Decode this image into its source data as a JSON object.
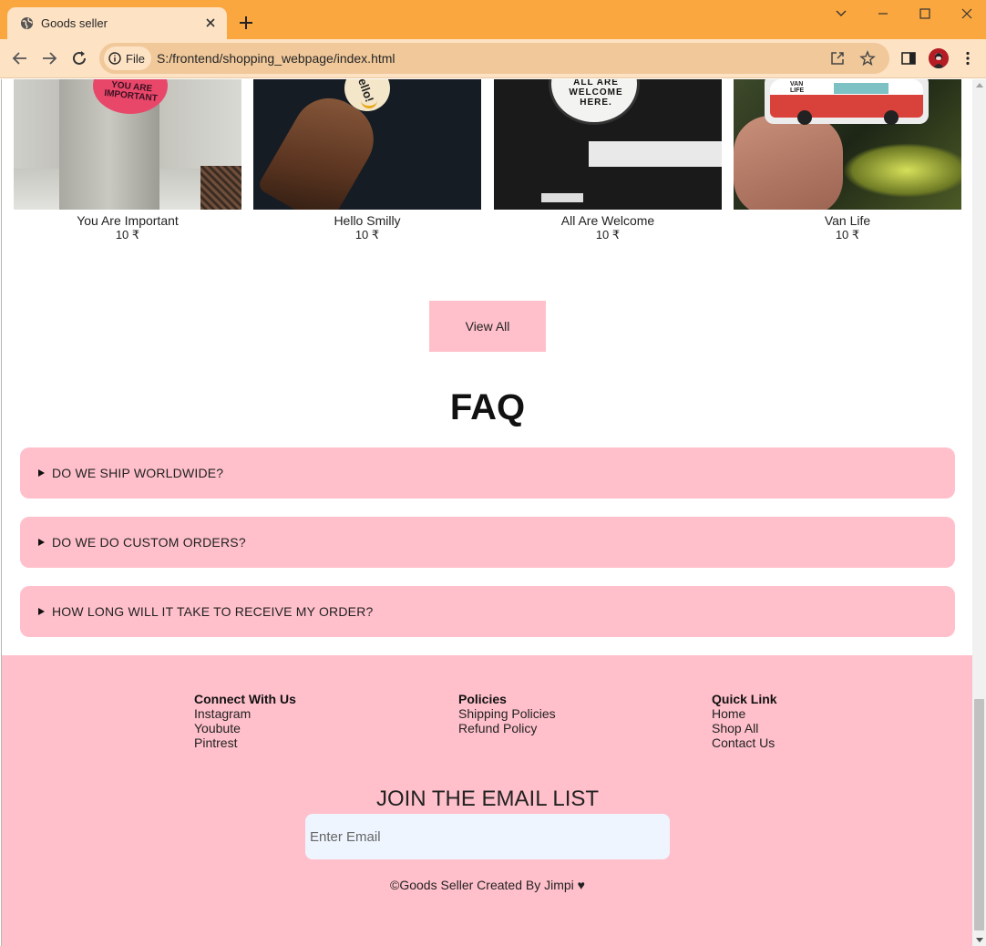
{
  "browser": {
    "tab_title": "Goods seller",
    "chip_label": "File",
    "url": "S:/frontend/shopping_webpage/index.html"
  },
  "products": [
    {
      "name": "You Are Important",
      "price": "10 ₹",
      "sticker_text": "YOU ARE IMPORTANT"
    },
    {
      "name": "Hello Smilly",
      "price": "10 ₹",
      "sticker_text": "Hello!"
    },
    {
      "name": "All Are Welcome",
      "price": "10 ₹",
      "sticker_text": "ALL ARE WELCOME HERE."
    },
    {
      "name": "Van Life",
      "price": "10 ₹",
      "sticker_text": "VAN LIFE"
    }
  ],
  "view_all_label": "View All",
  "faq": {
    "title": "FAQ",
    "items": [
      "DO WE SHIP WORLDWIDE?",
      "DO WE DO CUSTOM ORDERS?",
      "HOW LONG WILL IT TAKE TO RECEIVE MY ORDER?"
    ]
  },
  "footer": {
    "columns": [
      {
        "heading": "Connect With Us",
        "links": [
          "Instagram",
          "Youbute",
          "Pintrest"
        ]
      },
      {
        "heading": "Policies",
        "links": [
          "Shipping Policies",
          "Refund Policy"
        ]
      },
      {
        "heading": "Quick Link",
        "links": [
          "Home",
          "Shop All",
          "Contact Us"
        ]
      }
    ],
    "join_title": "JOIN THE EMAIL LIST",
    "email_placeholder": "Enter Email",
    "copyright": "©Goods Seller Created By Jimpi ♥"
  },
  "colors": {
    "tabbar": "#fba73f",
    "toolbar": "#fde2c4",
    "accent_pink": "#ffc0cb",
    "email_bg": "#eef5ff"
  }
}
